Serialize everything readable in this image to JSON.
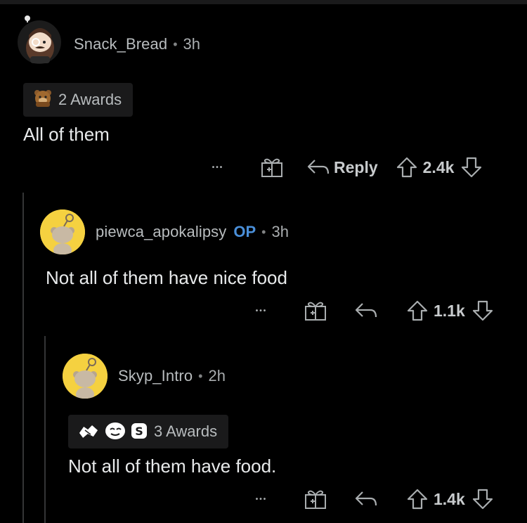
{
  "comments": [
    {
      "username": "Snack_Bread",
      "separator": "•",
      "time": "3h",
      "awards_label": "2 Awards",
      "body": "All of them",
      "more": "•••",
      "reply_label": "Reply",
      "score": "2.4k"
    },
    {
      "username": "piewca_apokalipsy",
      "op_badge": "OP",
      "separator": "•",
      "time": "3h",
      "body": "Not all of them have nice food",
      "more": "•••",
      "score": "1.1k"
    },
    {
      "username": "Skyp_Intro",
      "separator": "•",
      "time": "2h",
      "awards_label": "3 Awards",
      "body": "Not all of them have food.",
      "more": "•••",
      "score": "1.4k"
    }
  ],
  "icons": {
    "gift": "gift-icon",
    "reply": "reply-arrow-icon",
    "upvote": "upvote-arrow-icon",
    "downvote": "downvote-arrow-icon",
    "more": "more-options-icon"
  },
  "colors": {
    "background": "#000000",
    "op_blue": "#4a8fd9",
    "avatar_yellow": "#f5d140",
    "text": "#d7dadc"
  }
}
